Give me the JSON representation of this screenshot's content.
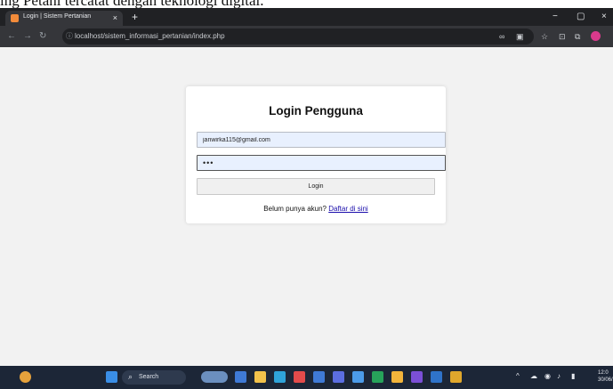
{
  "caption": "ing Petani tercatat dengan teknologi digital.",
  "browser": {
    "tab_title": "Login | Sistem Pertanian",
    "tab_close": "×",
    "new_tab": "+",
    "url": "localhost/sistem_informasi_pertanian/index.php",
    "controls": {
      "minimize": "−",
      "maximize": "▢",
      "close": "×"
    }
  },
  "login": {
    "title": "Login Pengguna",
    "email_value": "janwirka115@gmail.com",
    "password_value": "•••",
    "button_label": "Login",
    "register_prompt": "Belum punya akun?",
    "register_link": "Daftar di sini"
  },
  "taskbar": {
    "search_placeholder": "Search",
    "clock_time": "12:0",
    "clock_date": "30/06/202",
    "colors": {
      "start": "#3a8ee6",
      "icons": [
        "#3f7ad6",
        "#f2c24b",
        "#2fa3d9",
        "#e34b4b",
        "#3f7ad6",
        "#5b6ee1",
        "#4c9be8",
        "#27a35a",
        "#f2b43b",
        "#7b4fd6",
        "#2f73c9",
        "#e0a72c"
      ]
    }
  },
  "colors": {
    "viewport_bg": "#f2f2f2",
    "field_bg": "#e8f0fe",
    "link": "#1a0dab"
  }
}
